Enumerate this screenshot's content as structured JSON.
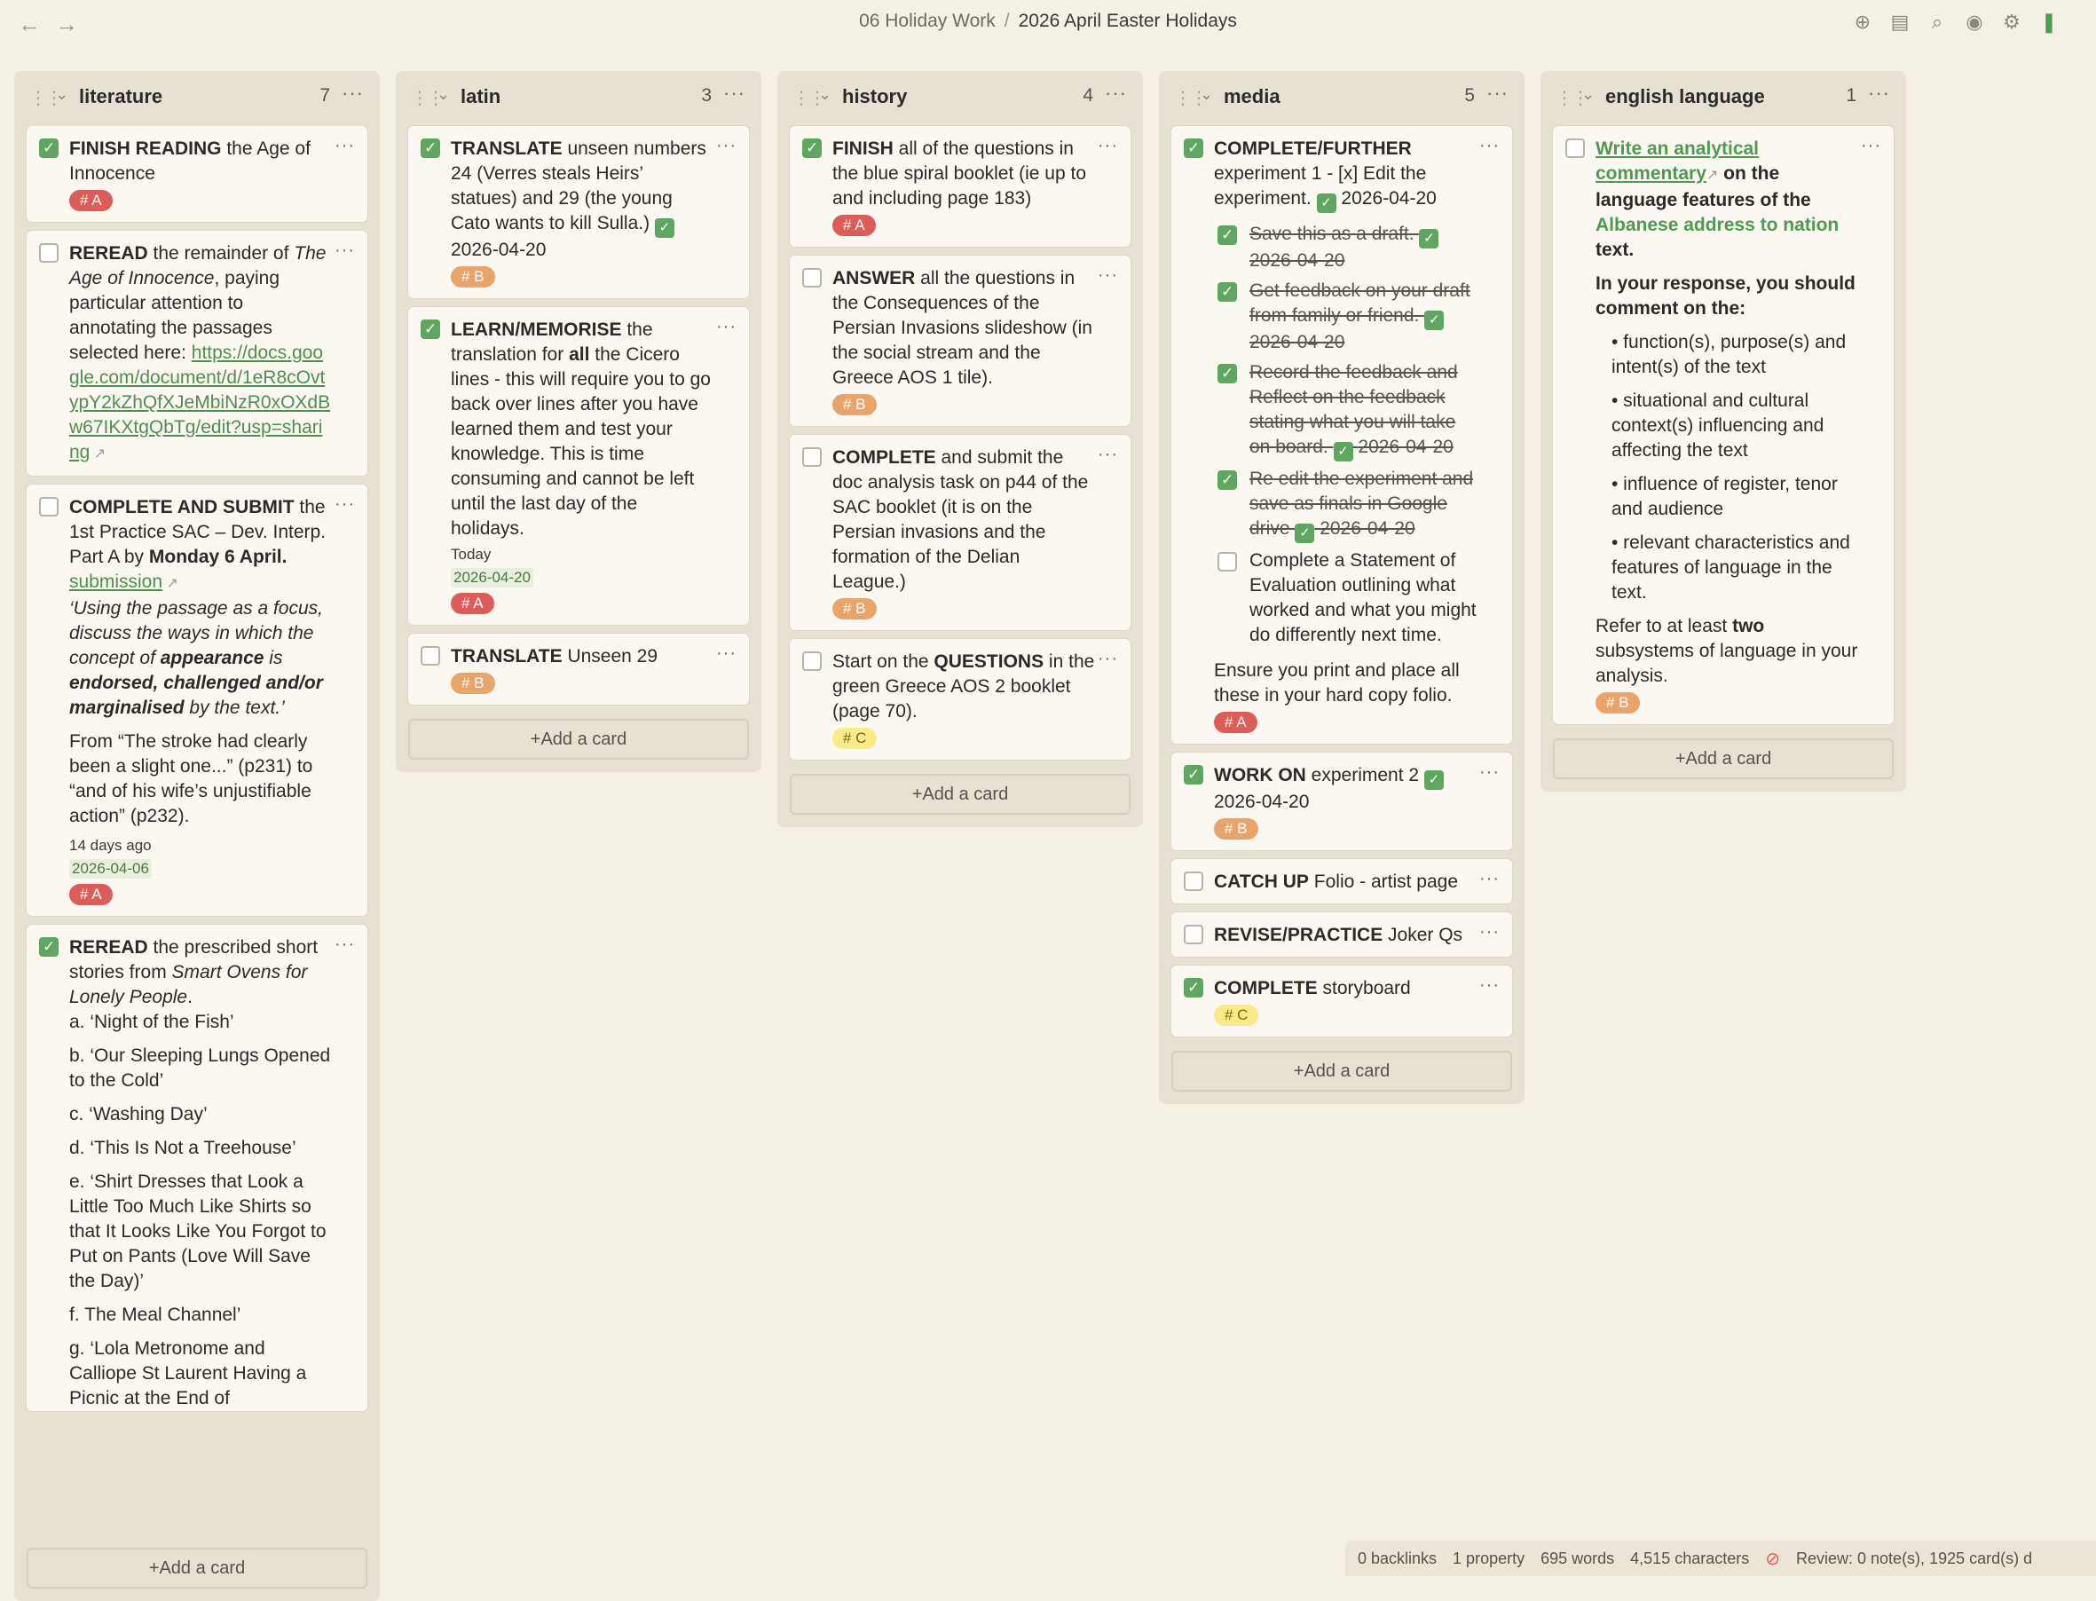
{
  "topbar": {
    "back": "←",
    "forward": "→",
    "breadcrumb_parent": "06 Holiday Work",
    "breadcrumb_sep": "/",
    "breadcrumb_current": "2026 April Easter Holidays",
    "actions": [
      "plus-circle-icon",
      "document-icon",
      "search-icon",
      "camera-icon",
      "gear-icon",
      "bookmark-icon"
    ]
  },
  "more": "···",
  "add_card_label": "+Add a card",
  "lanes": {
    "literature": {
      "title": "literature",
      "count": "7",
      "cards": [
        {
          "bold": "FINISH READING",
          "text": " the Age of Innocence",
          "tag": "# A"
        },
        {
          "bold": "REREAD",
          "text_1": " the remainder of ",
          "italic": "The Age of Innocence",
          "text_2": ", paying particular attention to annotating the passages selected here: ",
          "link": "https://docs.google.com/document/d/1eR8cOvtypY2kZhQfXJeMbiNzR0xOXdBw67IKXtgQbTg/edit?usp=sharing"
        },
        {
          "bold": "COMPLETE AND SUBMIT",
          "text_1": " the 1st Practice SAC – Dev. Interp. Part A by ",
          "bold_2": "Monday 6 April.",
          "link": "submission",
          "q_1": "‘Using the passage as a focus, discuss the ways in which the concept of ",
          "q_b1": "appearance",
          "q_2": " is ",
          "q_b2": "endorsed, challenged and/or marginalised",
          "q_3": " by the text.’",
          "from": "From “The stroke had clearly been a slight one...” (p231) to “and of his wife’s unjustifiable action” (p232).",
          "relative": "14 days ago",
          "date": "2026-04-06",
          "tag": "# A"
        },
        {
          "bold": "REREAD",
          "text_1": " the prescribed short stories from ",
          "italic": "Smart Ovens for Lonely People",
          "text_2": ".",
          "items": [
            "a. ‘Night of the Fish’",
            "b. ‘Our Sleeping Lungs Opened to the Cold’",
            "c. ‘Washing Day’",
            "d. ‘This Is Not a Treehouse’",
            "e. ‘Shirt Dresses that Look a Little Too Much Like Shirts so that It Looks Like You Forgot to Put on Pants (Love Will Save the Day)’",
            "f.  The Meal Channel’",
            "g. ‘Lola Metronome and Calliope St Laurent Having a Picnic at the End of"
          ]
        }
      ]
    },
    "latin": {
      "title": "latin",
      "count": "3",
      "cards": [
        {
          "bold": "TRANSLATE",
          "text": " unseen numbers 24 (Verres steals Heirs’ statues) and 29 (the young Cato wants to kill Sulla.) ",
          "date": "2026-04-20",
          "tag": "# B"
        },
        {
          "bold": "LEARN/MEMORISE",
          "text_1": " the translation for ",
          "bold_2": "all",
          "text_2": " the Cicero lines - this will require you to go back over lines after you have learned them and test your knowledge. This is time consuming and cannot be left until the last day of the holidays.",
          "relative": "Today",
          "date": "2026-04-20",
          "tag": "# A"
        },
        {
          "bold": "TRANSLATE",
          "text": " Unseen 29",
          "tag": "# B"
        }
      ]
    },
    "history": {
      "title": "history",
      "count": "4",
      "cards": [
        {
          "bold": "FINISH",
          "text": " all of the questions in the blue spiral booklet (ie up to and including page 183)",
          "tag": "# A"
        },
        {
          "bold": "ANSWER",
          "text": " all the questions in the Consequences of the Persian Invasions slideshow (in the social stream and the Greece AOS 1 tile).",
          "tag": "# B"
        },
        {
          "bold": "COMPLETE",
          "text": " and submit the doc analysis task on p44 of the SAC booklet (it is on the Persian invasions and the formation of the Delian League.)",
          "tag": "# B"
        },
        {
          "text_1": "Start on the ",
          "bold": "QUESTIONS",
          "text_2": " in the green Greece AOS 2 booklet (page 70).",
          "tag": "# C"
        }
      ]
    },
    "media": {
      "title": "media",
      "count": "5",
      "cards": [
        {
          "bold": "COMPLETE/FURTHER",
          "text": " experiment 1 - [x] Edit the experiment. ",
          "date": "2026-04-20",
          "subtasks": [
            {
              "text": "Save this as a draft. ",
              "date": "2026-04-20",
              "done": true
            },
            {
              "text": "Get feedback on your draft from family or friend. ",
              "date": "2026-04-20",
              "done": true
            },
            {
              "text": "Record the feedback and Reflect on the feedback stating what you will take on board. ",
              "date": "2026-04-20",
              "done": true
            },
            {
              "text": "Re edit the experiment and save as finals in Google drive ",
              "date": "2026-04-20",
              "done": true
            },
            {
              "text": "Complete a Statement of Evaluation outlining what worked and what you might do differently next time.",
              "date": "",
              "done": false
            }
          ],
          "footer": "Ensure you print and place all these in your hard copy folio.",
          "tag": "# A"
        },
        {
          "bold": "WORK ON",
          "text": " experiment 2 ",
          "date": "2026-04-20",
          "tag": "# B"
        },
        {
          "bold": "CATCH UP",
          "text": " Folio - artist page"
        },
        {
          "bold": "REVISE/PRACTICE",
          "text": " Joker Qs"
        },
        {
          "bold": "COMPLETE",
          "text": " storyboard",
          "tag": "# C"
        }
      ]
    },
    "english": {
      "title": "english language",
      "count": "1",
      "cards": [
        {
          "link": "Write an analytical commentary",
          "bold_1": " on the language features of the ",
          "green": "Albanese address to nation",
          "bold_2": " text.",
          "intro": "In your response, you should comment on the:",
          "bullets": [
            "• function(s), purpose(s) and intent(s) of the text",
            "• situational and cultural context(s) influencing and affecting the text",
            "• influence of register, tenor and audience",
            "• relevant characteristics and features of language in the text."
          ],
          "refer_1": "Refer to at least ",
          "refer_bold": "two",
          "refer_2": " subsystems of language in your analysis.",
          "tag": "# B"
        }
      ]
    }
  },
  "statusbar": {
    "backlinks": "0 backlinks",
    "property": "1 property",
    "words": "695 words",
    "characters": "4,515 characters",
    "review": "Review: 0 note(s), 1925 card(s) d"
  },
  "colors": {
    "accent_green": "#5fa660",
    "tag_a": "#dc5d58",
    "tag_b": "#e8a56b",
    "tag_c": "#fbe98a",
    "background": "#f5f0e6",
    "lane": "#e7e1d4"
  }
}
